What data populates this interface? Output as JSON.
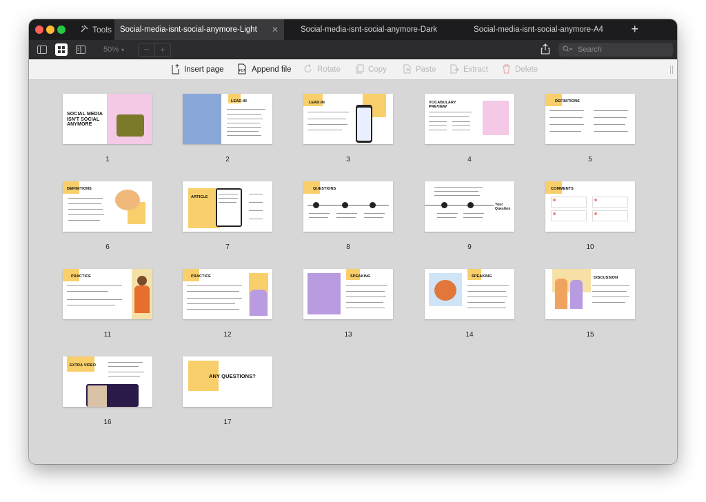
{
  "window": {
    "tools_label": "Tools",
    "tabs": [
      {
        "label": "Social-media-isnt-social-anymore-Light",
        "active": true
      },
      {
        "label": "Social-media-isnt-social-anymore-Dark",
        "active": false
      },
      {
        "label": "Social-media-isnt-social-anymore-A4",
        "active": false
      }
    ],
    "zoom": "50%",
    "search_placeholder": "Search"
  },
  "actions": {
    "insert_page": "Insert page",
    "append_file": "Append file",
    "rotate": "Rotate",
    "copy": "Copy",
    "paste": "Paste",
    "extract": "Extract",
    "delete": "Delete"
  },
  "pages": [
    {
      "number": "1",
      "title": "SOCIAL MEDIA ISN'T SOCIAL ANYMORE"
    },
    {
      "number": "2",
      "title": "LEAD-IN"
    },
    {
      "number": "3",
      "title": "LEAD-IN"
    },
    {
      "number": "4",
      "title": "VOCABULARY PREVIEW"
    },
    {
      "number": "5",
      "title": "DEFINITIONS"
    },
    {
      "number": "6",
      "title": "DEFINITIONS"
    },
    {
      "number": "7",
      "title": "ARTICLE"
    },
    {
      "number": "8",
      "title": "QUESTIONS"
    },
    {
      "number": "9",
      "title": "Your Question"
    },
    {
      "number": "10",
      "title": "COMMENTS"
    },
    {
      "number": "11",
      "title": "PRACTICE"
    },
    {
      "number": "12",
      "title": "PRACTICE"
    },
    {
      "number": "13",
      "title": "SPEAKING"
    },
    {
      "number": "14",
      "title": "SPEAKING"
    },
    {
      "number": "15",
      "title": "DISCUSSION"
    },
    {
      "number": "16",
      "title": "EXTRA VIDEO"
    },
    {
      "number": "17",
      "title": "ANY QUESTIONS?"
    }
  ],
  "colors": {
    "accent_yellow": "#f9cf6b",
    "accent_pink": "#f3c9e6",
    "accent_purple": "#b99be2",
    "tabbar": "#1c1c1e"
  }
}
